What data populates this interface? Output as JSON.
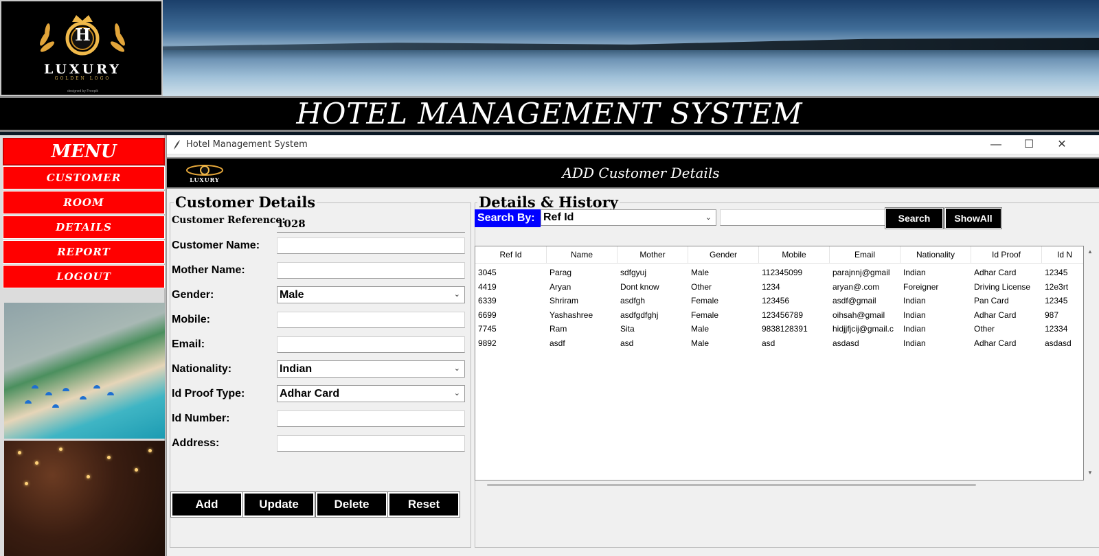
{
  "banner": {
    "logo_word": "LUXURY",
    "logo_sub": "GOLDEN LOGO",
    "logo_designed": "designed by Freepik",
    "logo_letter": "H",
    "title": "HOTEL MANAGEMENT SYSTEM"
  },
  "menu": {
    "header": "MENU",
    "items": [
      "CUSTOMER",
      "ROOM",
      "DETAILS",
      "REPORT",
      "LOGOUT"
    ]
  },
  "window": {
    "title": "Hotel Management System",
    "minimize": "—",
    "maximize": "☐",
    "close": "✕",
    "header_logo": "LUXURY",
    "header_title": "ADD Customer Details"
  },
  "customer_form": {
    "frame_title": "Customer Details",
    "fields": {
      "ref_label": "Customer Reference:",
      "ref_value": "1028",
      "name_label": "Customer Name:",
      "mother_label": "Mother Name:",
      "gender_label": "Gender:",
      "gender_value": "Male",
      "mobile_label": "Mobile:",
      "email_label": "Email:",
      "nationality_label": "Nationality:",
      "nationality_value": "Indian",
      "idproof_label": "Id Proof Type:",
      "idproof_value": "Adhar Card",
      "idnumber_label": "Id Number:",
      "address_label": "Address:"
    },
    "buttons": {
      "add": "Add",
      "update": "Update",
      "delete": "Delete",
      "reset": "Reset"
    }
  },
  "history": {
    "frame_title": "Details & History",
    "search_by_label": "Search By:",
    "search_by_value": "Ref Id",
    "search_button": "Search",
    "showall_button": "ShowAll",
    "columns": [
      "Ref Id",
      "Name",
      "Mother",
      "Gender",
      "Mobile",
      "Email",
      "Nationality",
      "Id Proof",
      "Id N"
    ],
    "rows": [
      [
        "3045",
        "Parag",
        "sdfgyuj",
        "Male",
        "112345099",
        "parajnnj@gmail",
        "Indian",
        "Adhar Card",
        "12345"
      ],
      [
        "4419",
        "Aryan",
        "Dont know",
        "Other",
        "1234",
        "aryan@.com",
        "Foreigner",
        "Driving License",
        "12e3rt"
      ],
      [
        "6339",
        "Shriram",
        "asdfgh",
        "Female",
        "123456",
        "asdf@gmail",
        "Indian",
        "Pan Card",
        "12345"
      ],
      [
        "6699",
        "Yashashree",
        "asdfgdfghj",
        "Female",
        "123456789",
        "oihsah@gmail",
        "Indian",
        "Adhar Card",
        "987"
      ],
      [
        "7745",
        "Ram",
        "Sita",
        "Male",
        "9838128391",
        "hidjjfjcij@gmail.c",
        "Indian",
        "Other",
        "12334"
      ],
      [
        "9892",
        "asdf",
        "asd",
        "Male",
        "asd",
        "asdasd",
        "Indian",
        "Adhar Card",
        "asdasd"
      ]
    ]
  },
  "colors": {
    "menu_red": "#ff0000",
    "search_blue": "#0000ff",
    "button_black": "#000000"
  }
}
